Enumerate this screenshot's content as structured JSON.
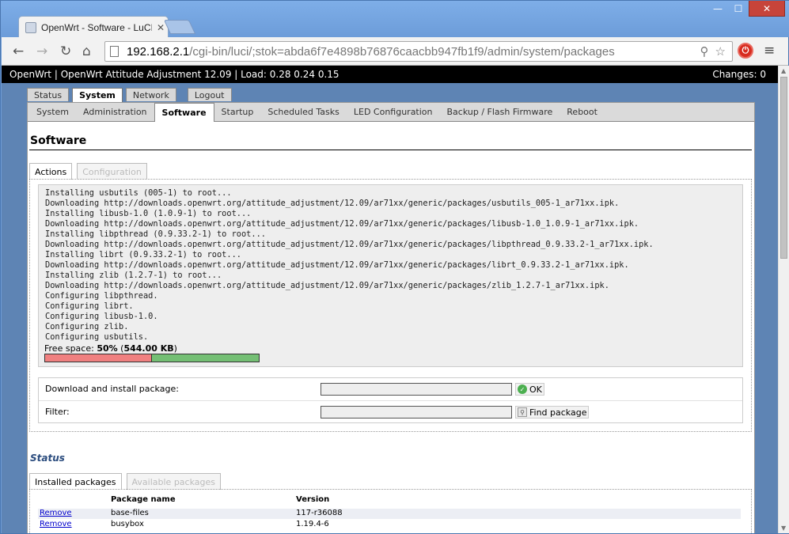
{
  "browser": {
    "tab_title": "OpenWrt - Software - LuCI",
    "url_host": "192.168.2.1",
    "url_path": "/cgi-bin/luci/;stok=abda6f7e4898b76876caacbb947fb1f9/admin/system/packages",
    "window_minimize": "—",
    "window_maximize": "☐",
    "window_close": "✕"
  },
  "header": {
    "text": "OpenWrt | OpenWrt Attitude Adjustment 12.09 | Load: 0.28 0.24 0.15",
    "changes": "Changes: 0"
  },
  "main_tabs": [
    "Status",
    "System",
    "Network"
  ],
  "logout_label": "Logout",
  "sub_tabs": [
    "System",
    "Administration",
    "Software",
    "Startup",
    "Scheduled Tasks",
    "LED Configuration",
    "Backup / Flash Firmware",
    "Reboot"
  ],
  "page_title": "Software",
  "content_tabs": [
    "Actions",
    "Configuration"
  ],
  "log_lines": [
    "Installing usbutils (005-1) to root...",
    "Downloading http://downloads.openwrt.org/attitude_adjustment/12.09/ar71xx/generic/packages/usbutils_005-1_ar71xx.ipk.",
    "Installing libusb-1.0 (1.0.9-1) to root...",
    "Downloading http://downloads.openwrt.org/attitude_adjustment/12.09/ar71xx/generic/packages/libusb-1.0_1.0.9-1_ar71xx.ipk.",
    "Installing libpthread (0.9.33.2-1) to root...",
    "Downloading http://downloads.openwrt.org/attitude_adjustment/12.09/ar71xx/generic/packages/libpthread_0.9.33.2-1_ar71xx.ipk.",
    "Installing librt (0.9.33.2-1) to root...",
    "Downloading http://downloads.openwrt.org/attitude_adjustment/12.09/ar71xx/generic/packages/librt_0.9.33.2-1_ar71xx.ipk.",
    "Installing zlib (1.2.7-1) to root...",
    "Downloading http://downloads.openwrt.org/attitude_adjustment/12.09/ar71xx/generic/packages/zlib_1.2.7-1_ar71xx.ipk.",
    "Configuring libpthread.",
    "Configuring librt.",
    "Configuring libusb-1.0.",
    "Configuring zlib.",
    "Configuring usbutils."
  ],
  "free_space": {
    "label": "Free space: ",
    "percent": "50%",
    "amount": "544.00 KB",
    "used_fraction": 0.5
  },
  "download": {
    "label": "Download and install package:",
    "value": "",
    "button": "OK"
  },
  "filter": {
    "label": "Filter:",
    "value": "",
    "button": "Find package"
  },
  "status_title": "Status",
  "package_tabs": [
    "Installed packages",
    "Available packages"
  ],
  "package_table": {
    "headers": [
      "Package name",
      "Version"
    ],
    "remove_label": "Remove",
    "rows": [
      {
        "name": "base-files",
        "version": "117-r36088"
      },
      {
        "name": "busybox",
        "version": "1.19.4-6"
      }
    ]
  },
  "colors": {
    "used_bar": "#f08080",
    "free_bar": "#74bf74",
    "header_bg": "#000000",
    "status_title": "#2b4c7e"
  }
}
